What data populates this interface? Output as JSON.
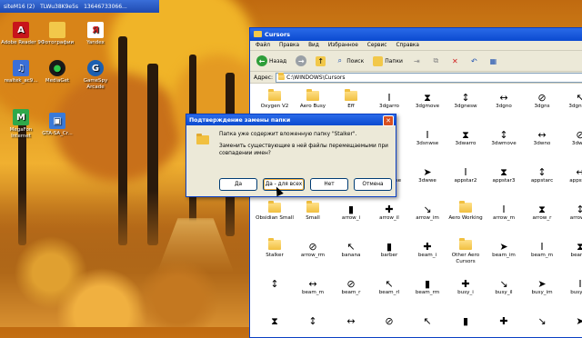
{
  "taskbar": {
    "title": "siteM16 (2)",
    "item2": "TLWu38K9e5s",
    "item3": "13646733066..."
  },
  "desktop_icons": [
    {
      "label": "Adobe Reader 9",
      "icon": "pdf-icon",
      "color": "#c8151b"
    },
    {
      "label": "Фотографии",
      "icon": "folder-icon",
      "color": "#f2c84a"
    },
    {
      "label": "Yandex",
      "icon": "yandex-icon",
      "color": "#cc2222"
    },
    {
      "label": "realtek_ac9...",
      "icon": "realtek-icon",
      "color": "#3a6fd8"
    },
    {
      "label": "MediaGet",
      "icon": "mediaget-icon",
      "color": "#2e9e3a"
    },
    {
      "label": "GameSpy Arcade",
      "icon": "gamespy-icon",
      "color": "#1b5fb0"
    },
    {
      "label": "MegaFon Internet",
      "icon": "megafon-icon",
      "color": "#2ea84a"
    },
    {
      "label": "GTA-SA_Cr...",
      "icon": "gta-icon",
      "color": "#3a7ad8"
    }
  ],
  "explorer": {
    "title": "Cursors",
    "menu": [
      "Файл",
      "Правка",
      "Вид",
      "Избранное",
      "Сервис",
      "Справка"
    ],
    "toolbar": {
      "back": "Назад",
      "search": "Поиск",
      "folders": "Папки"
    },
    "address_label": "Адрес:",
    "address": "C:\\WINDOWS\\Cursors",
    "items": [
      "Oxygen V2",
      "Aero Busy",
      "Eff",
      "3dgarro",
      "3dgmove",
      "3dgnesw",
      "3dgno",
      "3dgns",
      "3dgnwse",
      "",
      "",
      "",
      "3dsns",
      "3dsnwse",
      "3dwarro",
      "3dwmove",
      "3dwno",
      "3dwns",
      "",
      "",
      "",
      "3dwnwse",
      "3dwwe",
      "appstar2",
      "appstar3",
      "appstarc",
      "appstart",
      "Obsidian Small",
      "Small",
      "arrow_i",
      "arrow_il",
      "arrow_im",
      "Aero Working",
      "arrow_m",
      "arrow_r",
      "arrow_rl",
      "Stalker",
      "arrow_rm",
      "banana",
      "barber",
      "beam_i",
      "Other Aero Cursors",
      "beam_im",
      "beam_m",
      "beam_r",
      "",
      "beam_m",
      "beam_r",
      "beam_rl",
      "beam_rm",
      "busy_i",
      "busy_il",
      "busy_im",
      "busy_m",
      "",
      "",
      "",
      "",
      "",
      "",
      "",
      "",
      ""
    ]
  },
  "dialog": {
    "title": "Подтверждение замены папки",
    "line1": "Папка уже содержит вложенную папку \"Stalker\".",
    "line2": "Заменить существующие в ней файлы перемещаемыми при совпадении имен?",
    "btn_yes": "Да",
    "btn_yes_all": "Да - для всех",
    "btn_no": "Нет",
    "btn_cancel": "Отмена"
  }
}
